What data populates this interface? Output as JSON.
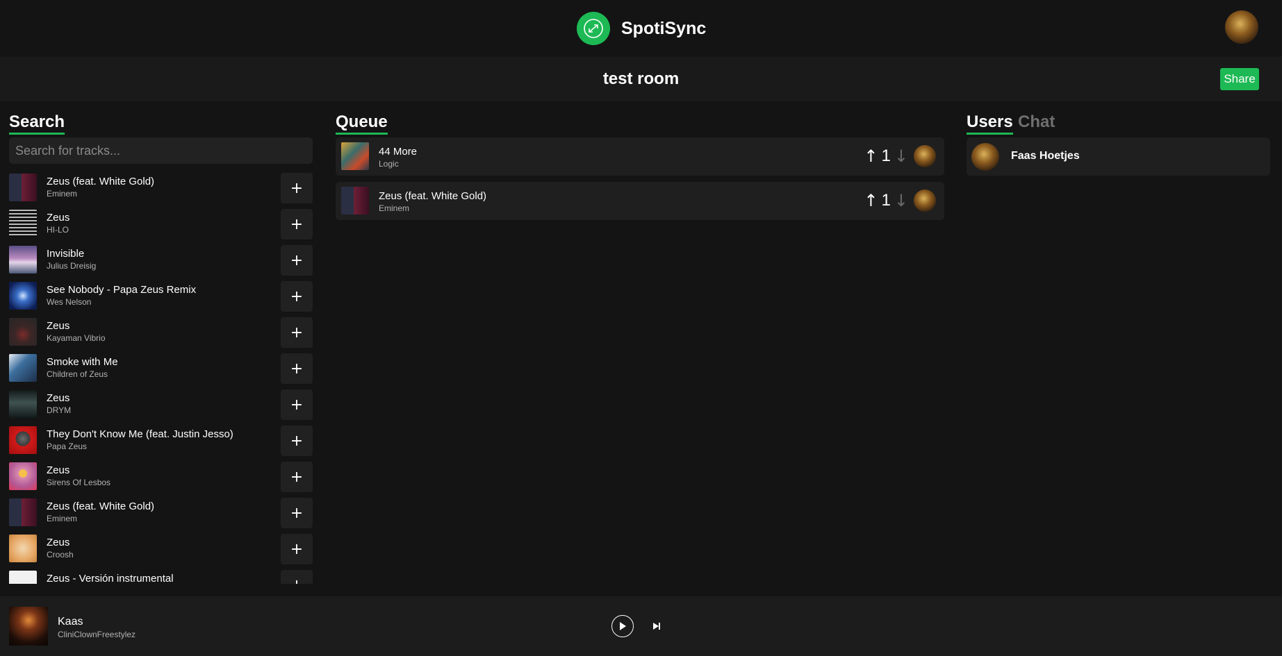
{
  "header": {
    "app_name": "SpotiSync",
    "logo_icon": "sync-arrows-icon",
    "brand_color": "#1db954"
  },
  "room": {
    "title": "test room",
    "share_label": "Share"
  },
  "search": {
    "heading": "Search",
    "placeholder": "Search for tracks...",
    "add_label": "+",
    "results": [
      {
        "title": "Zeus (feat. White Gold)",
        "artist": "Eminem"
      },
      {
        "title": "Zeus",
        "artist": "HI-LO"
      },
      {
        "title": "Invisible",
        "artist": "Julius Dreisig"
      },
      {
        "title": "See Nobody - Papa Zeus Remix",
        "artist": "Wes Nelson"
      },
      {
        "title": "Zeus",
        "artist": "Kayaman Vibrio"
      },
      {
        "title": "Smoke with Me",
        "artist": "Children of Zeus"
      },
      {
        "title": "Zeus",
        "artist": "DRYM"
      },
      {
        "title": "They Don't Know Me (feat. Justin Jesso)",
        "artist": "Papa Zeus"
      },
      {
        "title": "Zeus",
        "artist": "Sirens Of Lesbos"
      },
      {
        "title": "Zeus (feat. White Gold)",
        "artist": "Eminem"
      },
      {
        "title": "Zeus",
        "artist": "Croosh"
      },
      {
        "title": "Zeus - Versión instrumental",
        "artist": ""
      }
    ]
  },
  "queue": {
    "heading": "Queue",
    "items": [
      {
        "title": "44 More",
        "artist": "Logic",
        "votes": "1"
      },
      {
        "title": "Zeus (feat. White Gold)",
        "artist": "Eminem",
        "votes": "1"
      }
    ]
  },
  "panel": {
    "tab_users": "Users",
    "tab_chat": "Chat",
    "users": [
      {
        "name": "Faas Hoetjes"
      }
    ]
  },
  "player": {
    "title": "Kaas",
    "artist": "CliniClownFreestylez"
  }
}
